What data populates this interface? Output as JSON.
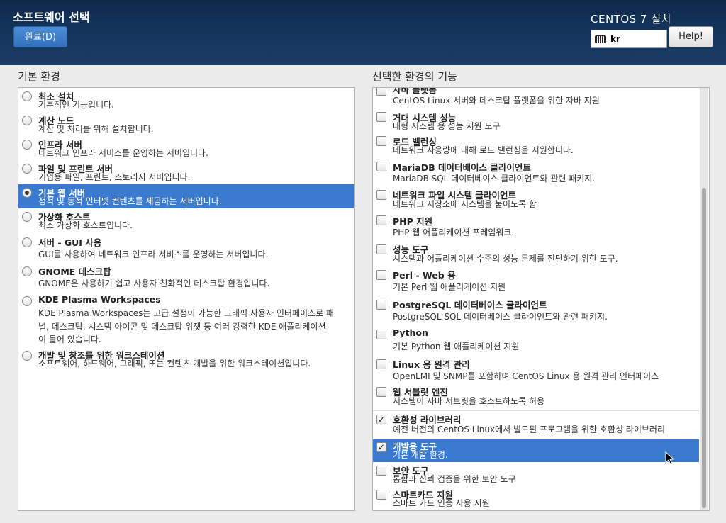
{
  "header": {
    "title": "소프트웨어 선택",
    "done_label": "완료(D)",
    "product": "CENTOS 7 설치",
    "keyboard": "kr",
    "help_label": "Help!"
  },
  "left": {
    "label": "기본 환경",
    "items": [
      {
        "title": "최소 설치",
        "desc": "기본적인 기능입니다.",
        "selected": false
      },
      {
        "title": "계산 노드",
        "desc": "계산 및 처리를 위해 설치합니다.",
        "selected": false
      },
      {
        "title": "인프라 서버",
        "desc": "네트워크 인프라 서비스를 운영하는 서버입니다.",
        "selected": false
      },
      {
        "title": "파일 및 프린트 서버",
        "desc": "기업용 파일, 프린트, 스토리지 서버입니다.",
        "selected": false
      },
      {
        "title": "기본 웹 서버",
        "desc": "정적 및 동적 인터넷 컨텐츠를 제공하는 서버입니다.",
        "selected": true
      },
      {
        "title": "가상화 호스트",
        "desc": "최소 가상화 호스트입니다.",
        "selected": false
      },
      {
        "title": "서버 - GUI 사용",
        "desc": "GUI를 사용하여 네트워크 인프라 서비스를 운영하는 서버입니다.",
        "selected": false
      },
      {
        "title": "GNOME 데스크탑",
        "desc": "GNOME은 사용하기 쉽고 사용자 친화적인 데스크탑 환경입니다.",
        "selected": false
      },
      {
        "title": "KDE Plasma Workspaces",
        "desc": "KDE Plasma Workspaces는 고급 설정이 가능한 그래픽 사용자 인터페이스로 패",
        "desc2": "널, 데스크탑, 시스템 아이콘 및 데스크탑 위젯 등 여러 강력한 KDE 애플리케이션",
        "desc3": "이 들어 있습니다.",
        "selected": false
      },
      {
        "title": "개발 및 창조를 위한 워크스테이션",
        "desc": "소프트웨어, 하드웨어, 그래픽, 또는 컨텐츠 개발을 위한 워크스테이션입니다.",
        "selected": false
      }
    ]
  },
  "right": {
    "label": "선택한 환경의 기능",
    "items": [
      {
        "title": "자바 플랫폼",
        "desc": "CentOS Linux 서버와 데스크탑 플랫폼을 위한 자바 지원",
        "checked": false
      },
      {
        "title": "거대 시스템 성능",
        "desc": "대형 시스템 용 성능 지원 도구",
        "checked": false
      },
      {
        "title": "로드 밸런싱",
        "desc": "네트워크 사용량에 대해 로드 밸런싱을 지원합니다.",
        "checked": false
      },
      {
        "title": "MariaDB 데이터베이스 클라이언트",
        "desc": "MariaDB SQL 데이터베이스 클라이언트와 관련 패키지.",
        "checked": false
      },
      {
        "title": "네트워크 파일 시스템 클라이언트",
        "desc": "네트워크 저장소에 시스템을 붙이도록 함",
        "checked": false
      },
      {
        "title": "PHP 지원",
        "desc": "PHP 웹 어플리케이션 프레임워크.",
        "checked": false
      },
      {
        "title": "성능 도구",
        "desc": "시스템과 어플리케이션 수준의 성능 문제를 진단하기 위한 도구.",
        "checked": false
      },
      {
        "title": "Perl - Web 용",
        "desc": "기본 Perl 웹 애플리케이션 지원",
        "checked": false
      },
      {
        "title": "PostgreSQL 데이터베이스 클라이언트",
        "desc": "PostgreSQL SQL 데이터베이스 클라이언트와 관련 패키지.",
        "checked": false
      },
      {
        "title": "Python",
        "desc": "기본 Python 웹 애플리케이션 지원",
        "checked": false
      },
      {
        "title": "Linux 용 원격 관리",
        "desc": "OpenLMI 및 SNMP를 포함하여 CentOS Linux 용 원격 관리 인터페이스",
        "checked": false
      },
      {
        "title": "웹 서블릿 엔진",
        "desc": "시스템이 자바 서브릿을 호스트하도록 허용",
        "checked": false
      },
      {
        "title": "호환성 라이브러리",
        "desc": "예전 버전의 CentOS Linux에서 빌드된 프로그램을 위한 호환성 라이브러리",
        "checked": true
      },
      {
        "title": "개발용 도구",
        "desc": "기본 개발 환경.",
        "checked": true,
        "selected": true
      },
      {
        "title": "보안 도구",
        "desc": "통합과 신뢰 검증을 위한 보안 도구",
        "checked": false
      },
      {
        "title": "스마트카드 지원",
        "desc": "스마트 카드 인증 사용 지원",
        "checked": false
      }
    ]
  }
}
